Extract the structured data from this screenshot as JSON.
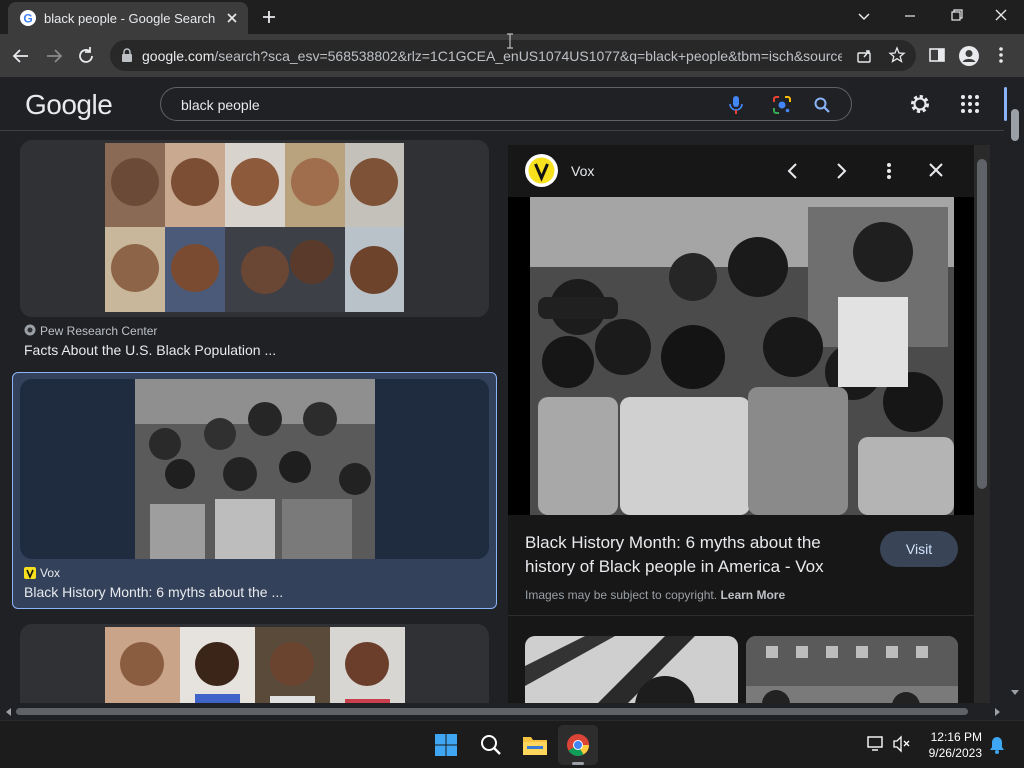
{
  "browser": {
    "tab_title": "black people - Google Search",
    "url_host": "google.com",
    "url_path": "/search?sca_esv=568538802&rlz=1C1GCEA_enUS1074US1077&q=black+people&tbm=isch&source..."
  },
  "google": {
    "logo": "Google",
    "search_query": "black people"
  },
  "results": [
    {
      "source": "Pew Research Center",
      "title": "Facts About the U.S. Black Population ..."
    },
    {
      "source": "Vox",
      "title": "Black History Month: 6 myths about the ..."
    }
  ],
  "panel": {
    "source": "Vox",
    "title": "Black History Month: 6 myths about the history of Black people in America - Vox",
    "visit_label": "Visit",
    "copyright_prefix": "Images may be subject to copyright.",
    "learn_more": "Learn More"
  },
  "taskbar": {
    "time": "12:16 PM",
    "date": "9/26/2023"
  },
  "colors": {
    "accent_blue": "#8ab4f8",
    "vox_yellow": "#f7e11e",
    "selected_card": "#33415a"
  }
}
